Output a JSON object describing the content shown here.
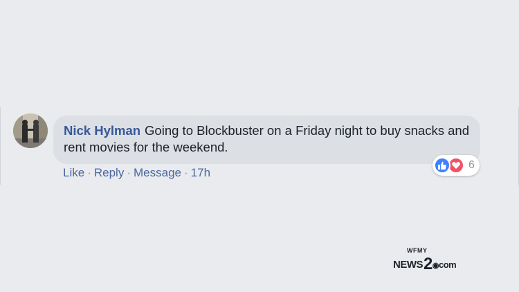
{
  "comment": {
    "author": "Nick Hylman",
    "text": "Going to Blockbuster on a Friday night to buy snacks and rent movies for the weekend.",
    "actions": {
      "like": "Like",
      "reply": "Reply",
      "message": "Message",
      "separator": "·",
      "time": "17h"
    },
    "reactions": {
      "icons": [
        "like-icon",
        "love-icon"
      ],
      "count": "6"
    }
  },
  "branding": {
    "small": "WFMY",
    "main": "NEWS",
    "number": "2",
    "suffix": "com"
  },
  "colors": {
    "background": "#e9ebee",
    "bubble": "#dcdfe3",
    "author": "#385898",
    "link": "#4b67a1",
    "like": "#4080ff",
    "love": "#f25268"
  }
}
